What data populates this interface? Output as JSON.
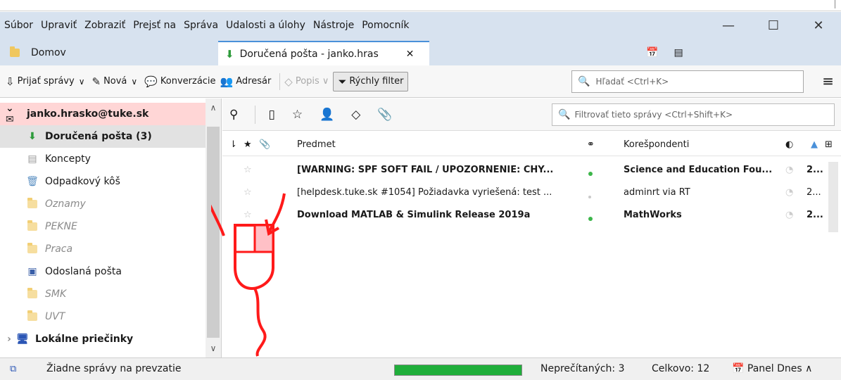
{
  "menubar": {
    "items": [
      "Súbor",
      "Upraviť",
      "Zobraziť",
      "Prejsť na",
      "Správa",
      "Udalosti a úlohy",
      "Nástroje",
      "Pomocník"
    ]
  },
  "tabs": {
    "home": "Domov",
    "inbox": "Doručená pošta - janko.hras"
  },
  "toolbar": {
    "get_mail": "Prijať správy",
    "new": "Nová",
    "chat": "Konverzácie",
    "address_book": "Adresár",
    "tag": "Popis",
    "quick_filter": "Rýchly filter",
    "search_placeholder": "Hľadať <Ctrl+K>"
  },
  "sidebar": {
    "account": "janko.hrasko@tuke.sk",
    "folders": [
      {
        "label": "Doručená pošta (3)"
      },
      {
        "label": "Koncepty"
      },
      {
        "label": "Odpadkový kôš"
      },
      {
        "label": "Oznamy"
      },
      {
        "label": "PEKNE"
      },
      {
        "label": "Praca"
      },
      {
        "label": "Odoslaná pošta"
      },
      {
        "label": "SMK"
      },
      {
        "label": "UVT"
      }
    ],
    "local": "Lokálne priečinky"
  },
  "filter": {
    "placeholder": "Filtrovať tieto správy <Ctrl+Shift+K>"
  },
  "columns": {
    "subject": "Predmet",
    "correspondents": "Korešpondenti"
  },
  "messages": [
    {
      "subject": "[WARNING: SPF SOFT FAIL / UPOZORNENIE: CHY...",
      "correspondent": "Science and Education Fou...",
      "date": "2...",
      "unread": true
    },
    {
      "subject": "[helpdesk.tuke.sk #1054] Požiadavka vyriešená: test ...",
      "correspondent": "adminrt via RT",
      "date": "2...",
      "unread": false
    },
    {
      "subject": "Download MATLAB & Simulink Release 2019a",
      "correspondent": "MathWorks",
      "date": "2...",
      "unread": true
    }
  ],
  "status": {
    "text": "Žiadne správy na prevzatie",
    "unread": "Neprečítaných: 3",
    "total": "Celkovo: 12",
    "panel": "Panel Dnes",
    "progress": 1.0
  },
  "colors": {
    "accent": "#4a90d9",
    "account_highlight": "#ffd6d6",
    "progress": "#1fae3a",
    "annotation": "#ff1a1a"
  }
}
